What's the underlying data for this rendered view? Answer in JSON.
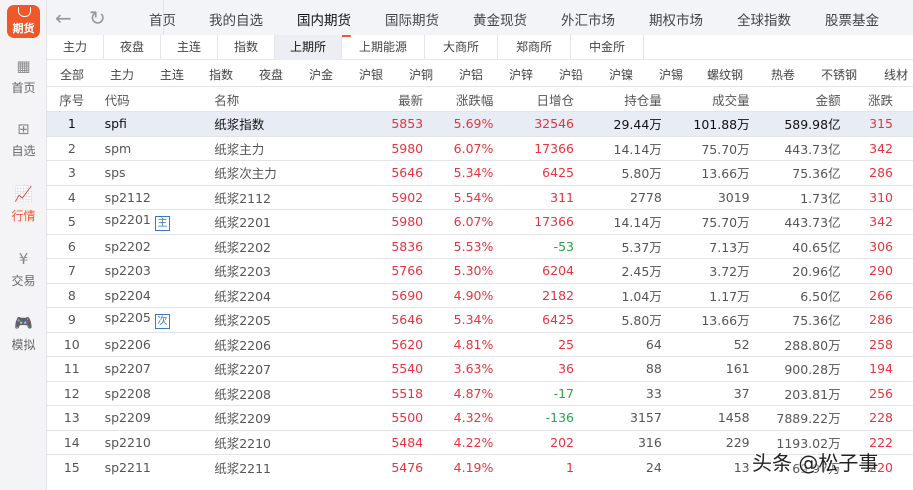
{
  "app": {
    "logo": "期货"
  },
  "sidebar": [
    {
      "label": "首页",
      "icon": "grid-icon"
    },
    {
      "label": "自选",
      "icon": "clipboard-plus-icon"
    },
    {
      "label": "行情",
      "icon": "chart-icon",
      "active": true
    },
    {
      "label": "交易",
      "icon": "yen-icon"
    },
    {
      "label": "模拟",
      "icon": "gamepad-icon"
    }
  ],
  "main_tabs": [
    "首页",
    "我的自选",
    "国内期货",
    "国际期货",
    "黄金现货",
    "外汇市场",
    "期权市场",
    "全球指数",
    "股票基金"
  ],
  "sub_tabs": [
    "主力",
    "夜盘",
    "主连",
    "指数",
    "上期所",
    "上期能源",
    "大商所",
    "郑商所",
    "中金所"
  ],
  "filters": [
    "全部",
    "主力",
    "主连",
    "指数",
    "夜盘",
    "沪金",
    "沪银",
    "沪铜",
    "沪铝",
    "沪锌",
    "沪铅",
    "沪镍",
    "沪锡",
    "螺纹钢",
    "热卷",
    "不锈钢",
    "线材"
  ],
  "columns": [
    "序号",
    "代码",
    "名称",
    "最新",
    "涨跌幅",
    "日增仓",
    "持仓量",
    "成交量",
    "金额",
    "涨跌"
  ],
  "rows": [
    [
      "1",
      "spfi",
      "",
      "纸浆指数",
      "5853",
      "5.69%",
      "32546",
      "29.44万",
      "101.88万",
      "589.98亿",
      "315"
    ],
    [
      "2",
      "spm",
      "",
      "纸浆主力",
      "5980",
      "6.07%",
      "17366",
      "14.14万",
      "75.70万",
      "443.73亿",
      "342"
    ],
    [
      "3",
      "sps",
      "",
      "纸浆次主力",
      "5646",
      "5.34%",
      "6425",
      "5.80万",
      "13.66万",
      "75.36亿",
      "286"
    ],
    [
      "4",
      "sp2112",
      "",
      "纸浆2112",
      "5902",
      "5.54%",
      "311",
      "2778",
      "3019",
      "1.73亿",
      "310"
    ],
    [
      "5",
      "sp2201",
      "主",
      "纸浆2201",
      "5980",
      "6.07%",
      "17366",
      "14.14万",
      "75.70万",
      "443.73亿",
      "342"
    ],
    [
      "6",
      "sp2202",
      "",
      "纸浆2202",
      "5836",
      "5.53%",
      "-53",
      "5.37万",
      "7.13万",
      "40.65亿",
      "306"
    ],
    [
      "7",
      "sp2203",
      "",
      "纸浆2203",
      "5766",
      "5.30%",
      "6204",
      "2.45万",
      "3.72万",
      "20.96亿",
      "290"
    ],
    [
      "8",
      "sp2204",
      "",
      "纸浆2204",
      "5690",
      "4.90%",
      "2182",
      "1.04万",
      "1.17万",
      "6.50亿",
      "266"
    ],
    [
      "9",
      "sp2205",
      "次",
      "纸浆2205",
      "5646",
      "5.34%",
      "6425",
      "5.80万",
      "13.66万",
      "75.36亿",
      "286"
    ],
    [
      "10",
      "sp2206",
      "",
      "纸浆2206",
      "5620",
      "4.81%",
      "25",
      "64",
      "52",
      "288.80万",
      "258"
    ],
    [
      "11",
      "sp2207",
      "",
      "纸浆2207",
      "5540",
      "3.63%",
      "36",
      "88",
      "161",
      "900.28万",
      "194"
    ],
    [
      "12",
      "sp2208",
      "",
      "纸浆2208",
      "5518",
      "4.87%",
      "-17",
      "33",
      "37",
      "203.81万",
      "256"
    ],
    [
      "13",
      "sp2209",
      "",
      "纸浆2209",
      "5500",
      "4.32%",
      "-136",
      "3157",
      "1458",
      "7889.22万",
      "228"
    ],
    [
      "14",
      "sp2210",
      "",
      "纸浆2210",
      "5484",
      "4.22%",
      "202",
      "316",
      "229",
      "1193.02万",
      "222"
    ],
    [
      "15",
      "sp2211",
      "",
      "纸浆2211",
      "5476",
      "4.19%",
      "1",
      "24",
      "13",
      "69.97万",
      "220"
    ]
  ],
  "watermark": "头条 @松子事",
  "colors": {
    "up": "#e8343d",
    "down": "#2aa545",
    "accent": "#f0582a"
  }
}
